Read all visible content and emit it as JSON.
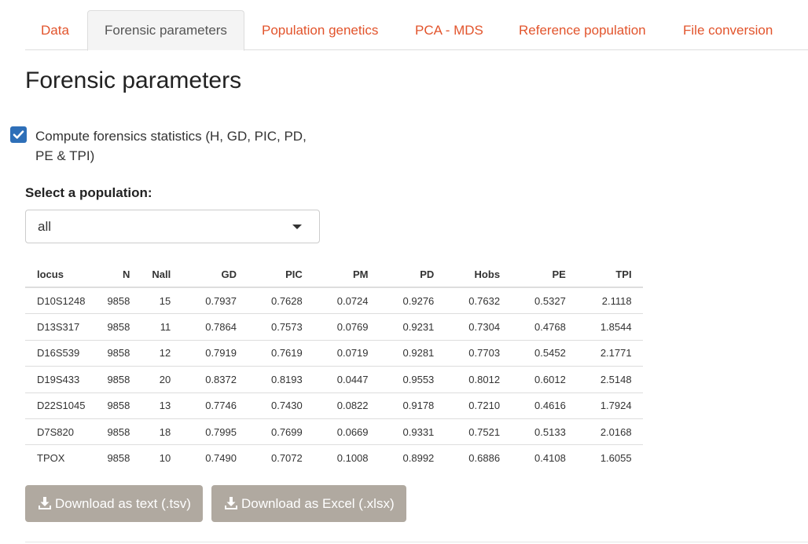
{
  "tabs": [
    {
      "label": "Data",
      "active": false
    },
    {
      "label": "Forensic parameters",
      "active": true
    },
    {
      "label": "Population genetics",
      "active": false
    },
    {
      "label": "PCA - MDS",
      "active": false
    },
    {
      "label": "Reference population",
      "active": false
    },
    {
      "label": "File conversion",
      "active": false
    }
  ],
  "page_title": "Forensic parameters",
  "checkbox": {
    "checked": true,
    "label": "Compute forensics statistics (H, GD, PIC, PD, PE & TPI)"
  },
  "population_select": {
    "label": "Select a population:",
    "value": "all"
  },
  "table": {
    "columns": [
      "locus",
      "N",
      "Nall",
      "GD",
      "PIC",
      "PM",
      "PD",
      "Hobs",
      "PE",
      "TPI"
    ],
    "rows": [
      [
        "D10S1248",
        "9858",
        "15",
        "0.7937",
        "0.7628",
        "0.0724",
        "0.9276",
        "0.7632",
        "0.5327",
        "2.1118"
      ],
      [
        "D13S317",
        "9858",
        "11",
        "0.7864",
        "0.7573",
        "0.0769",
        "0.9231",
        "0.7304",
        "0.4768",
        "1.8544"
      ],
      [
        "D16S539",
        "9858",
        "12",
        "0.7919",
        "0.7619",
        "0.0719",
        "0.9281",
        "0.7703",
        "0.5452",
        "2.1771"
      ],
      [
        "D19S433",
        "9858",
        "20",
        "0.8372",
        "0.8193",
        "0.0447",
        "0.9553",
        "0.8012",
        "0.6012",
        "2.5148"
      ],
      [
        "D22S1045",
        "9858",
        "13",
        "0.7746",
        "0.7430",
        "0.0822",
        "0.9178",
        "0.7210",
        "0.4616",
        "1.7924"
      ],
      [
        "D7S820",
        "9858",
        "18",
        "0.7995",
        "0.7699",
        "0.0669",
        "0.9331",
        "0.7521",
        "0.5133",
        "2.0168"
      ],
      [
        "TPOX",
        "9858",
        "10",
        "0.7490",
        "0.7072",
        "0.1008",
        "0.8992",
        "0.6886",
        "0.4108",
        "1.6055"
      ]
    ]
  },
  "buttons": {
    "download_tsv": "Download as text (.tsv)",
    "download_xlsx": "Download as Excel (.xlsx)"
  },
  "colors": {
    "tab_link": "#e2542c",
    "checkbox": "#2e6fb8",
    "button_bg": "#b0a9a0"
  },
  "icons": {
    "checkbox": "check-icon",
    "select": "caret-down-icon",
    "download": "download-icon"
  }
}
